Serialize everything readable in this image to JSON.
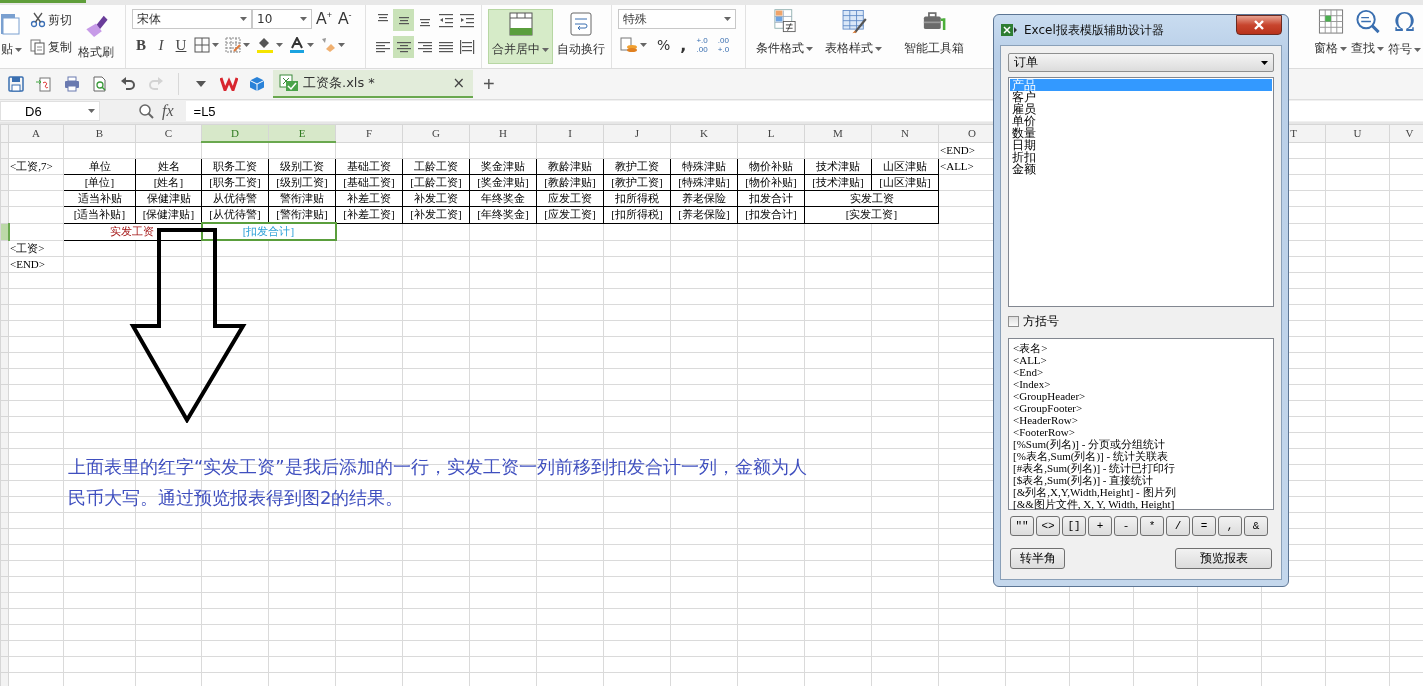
{
  "ribbon": {
    "paste": {
      "label": "贴"
    },
    "clipboard": [
      {
        "kind": "cut",
        "label": "剪切"
      },
      {
        "kind": "copy",
        "label": "复制"
      }
    ],
    "format_painter": {
      "label": "格式刷"
    },
    "font": {
      "name": "宋体",
      "size": "10",
      "size_buttons": [
        {
          "label": "A",
          "sign": "+"
        },
        {
          "label": "A",
          "sign": "-"
        }
      ],
      "styles": [
        {
          "kind": "bold",
          "label": "B"
        },
        {
          "kind": "italic",
          "label": "I"
        },
        {
          "kind": "underline",
          "label": "U"
        }
      ]
    },
    "alignment": [
      {
        "kind": "top",
        "selected": false
      },
      {
        "kind": "middle",
        "selected": true
      },
      {
        "kind": "bottom",
        "selected": false
      },
      {
        "kind": "outdent",
        "selected": false
      },
      {
        "kind": "indent",
        "selected": false
      },
      {
        "kind": "left",
        "selected": false
      },
      {
        "kind": "center",
        "selected": true
      },
      {
        "kind": "right",
        "selected": false
      },
      {
        "kind": "justify",
        "selected": false
      },
      {
        "kind": "distributed",
        "selected": false
      }
    ],
    "merge": {
      "label": "合并居中",
      "selected": true
    },
    "wrap": {
      "label": "自动换行",
      "selected": false
    },
    "number": {
      "format": "特殊",
      "percent": "%",
      "comma": ",",
      "decimals": [
        {
          "top": "+.0",
          "bottom": ".00"
        },
        {
          "top": ".00",
          "bottom": "+.0"
        }
      ]
    },
    "tools": [
      {
        "kind": "conditional",
        "label": "条件格式",
        "menu": true
      },
      {
        "kind": "table_style",
        "label": "表格样式",
        "menu": true
      },
      {
        "kind": "toolbox",
        "label": "智能工具箱",
        "menu": false
      }
    ],
    "right_tools": [
      {
        "kind": "freeze",
        "label": "窗格",
        "menu": true
      },
      {
        "kind": "find",
        "label": "查找",
        "menu": true
      },
      {
        "kind": "symbol",
        "glyph": "Ω",
        "label": "符号",
        "menu": true
      }
    ]
  },
  "quick_access": [
    {
      "kind": "save",
      "disabled": false
    },
    {
      "kind": "export",
      "disabled": false
    },
    {
      "kind": "print",
      "disabled": false
    },
    {
      "kind": "preview",
      "disabled": false
    },
    {
      "kind": "undo",
      "disabled": false
    },
    {
      "kind": "redo",
      "disabled": true
    }
  ],
  "document_tab": {
    "title": "工资条.xls *",
    "selected": true,
    "close": "×"
  },
  "new_tab": "+",
  "formula_bar": {
    "cell": "D6",
    "fx": "fx",
    "formula": "=L5"
  },
  "sheet": {
    "columns": [
      {
        "label": "A",
        "selected": false
      },
      {
        "label": "B",
        "selected": false
      },
      {
        "label": "C",
        "selected": false
      },
      {
        "label": "D",
        "selected": true
      },
      {
        "label": "E",
        "selected": true
      },
      {
        "label": "F",
        "selected": false
      },
      {
        "label": "G",
        "selected": false
      },
      {
        "label": "H",
        "selected": false
      },
      {
        "label": "I",
        "selected": false
      },
      {
        "label": "J",
        "selected": false
      },
      {
        "label": "K",
        "selected": false
      },
      {
        "label": "L",
        "selected": false
      },
      {
        "label": "M",
        "selected": false
      },
      {
        "label": "N",
        "selected": false
      },
      {
        "label": "O",
        "selected": false
      },
      {},
      {},
      {},
      {},
      {
        "label": "T",
        "selected": false
      },
      {
        "label": "U",
        "selected": false
      },
      {
        "label": "V",
        "selected": false
      }
    ],
    "rows": [
      {
        "selected": false,
        "cells": [
          {
            "selected": false
          },
          {
            "selected": false
          },
          {
            "selected": false
          },
          {
            "selected": false
          },
          {
            "selected": false
          },
          {
            "selected": false
          },
          {
            "selected": false
          },
          {
            "selected": false
          },
          {
            "selected": false
          },
          {
            "selected": false
          },
          {
            "selected": false
          },
          {
            "selected": false
          },
          {
            "selected": false
          },
          {
            "selected": false
          },
          {
            "text": "<END>",
            "kind": "tag",
            "boxed": false,
            "selected": false
          }
        ]
      },
      {
        "selected": false,
        "cells": [
          {
            "text": "<工资,7>",
            "kind": "tag",
            "boxed": false,
            "selected": false
          },
          {
            "text": "单位",
            "kind": "label",
            "boxed": true,
            "selected": false
          },
          {
            "text": "姓名",
            "kind": "label",
            "boxed": true,
            "selected": false
          },
          {
            "text": "职务工资",
            "kind": "label",
            "boxed": true,
            "selected": false
          },
          {
            "text": "级别工资",
            "kind": "label",
            "boxed": true,
            "selected": false
          },
          {
            "text": "基础工资",
            "kind": "label",
            "boxed": true,
            "selected": false
          },
          {
            "text": "工龄工资",
            "kind": "label",
            "boxed": true,
            "selected": false
          },
          {
            "text": "奖金津贴",
            "kind": "label",
            "boxed": true,
            "selected": false
          },
          {
            "text": "教龄津贴",
            "kind": "label",
            "boxed": true,
            "selected": false
          },
          {
            "text": "教护工资",
            "kind": "label",
            "boxed": true,
            "selected": false
          },
          {
            "text": "特殊津贴",
            "kind": "label",
            "boxed": true,
            "selected": false
          },
          {
            "text": "物价补贴",
            "kind": "label",
            "boxed": true,
            "selected": false
          },
          {
            "text": "技术津贴",
            "kind": "label",
            "boxed": true,
            "selected": false
          },
          {
            "text": "山区津贴",
            "kind": "label",
            "boxed": true,
            "selected": false
          },
          {
            "text": "<ALL>",
            "kind": "tag",
            "boxed": false,
            "selected": false
          }
        ]
      },
      {
        "selected": false,
        "cells": [
          {
            "selected": false
          },
          {
            "text": "[单位]",
            "kind": "field",
            "boxed": true,
            "selected": false
          },
          {
            "text": "[姓名]",
            "kind": "field",
            "boxed": true,
            "selected": false
          },
          {
            "text": "[职务工资]",
            "kind": "field",
            "boxed": true,
            "selected": false
          },
          {
            "text": "[级别工资]",
            "kind": "field",
            "boxed": true,
            "selected": false
          },
          {
            "text": "[基础工资]",
            "kind": "field",
            "boxed": true,
            "selected": false
          },
          {
            "text": "[工龄工资]",
            "kind": "field",
            "boxed": true,
            "selected": false
          },
          {
            "text": "[奖金津贴]",
            "kind": "field",
            "boxed": true,
            "selected": false
          },
          {
            "text": "[教龄津贴]",
            "kind": "field",
            "boxed": true,
            "selected": false
          },
          {
            "text": "[教护工资]",
            "kind": "field",
            "boxed": true,
            "selected": false
          },
          {
            "text": "[特殊津贴]",
            "kind": "field",
            "boxed": true,
            "selected": false
          },
          {
            "text": "[物价补贴]",
            "kind": "field",
            "boxed": true,
            "selected": false
          },
          {
            "text": "[技术津贴]",
            "kind": "field",
            "boxed": true,
            "selected": false
          },
          {
            "text": "[山区津贴]",
            "kind": "field",
            "boxed": true,
            "selected": false
          }
        ]
      },
      {
        "selected": false,
        "cells": [
          {
            "selected": false
          },
          {
            "text": "适当补贴",
            "kind": "label",
            "boxed": true,
            "selected": false
          },
          {
            "text": "保健津贴",
            "kind": "label",
            "boxed": true,
            "selected": false
          },
          {
            "text": "从优待警",
            "kind": "label",
            "boxed": true,
            "selected": false
          },
          {
            "text": "警衔津贴",
            "kind": "label",
            "boxed": true,
            "selected": false
          },
          {
            "text": "补差工资",
            "kind": "label",
            "boxed": true,
            "selected": false
          },
          {
            "text": "补发工资",
            "kind": "label",
            "boxed": true,
            "selected": false
          },
          {
            "text": "年终奖金",
            "kind": "label",
            "boxed": true,
            "selected": false
          },
          {
            "text": "应发工资",
            "kind": "label",
            "boxed": true,
            "selected": false
          },
          {
            "text": "扣所得税",
            "kind": "label",
            "boxed": true,
            "selected": false
          },
          {
            "text": "养老保险",
            "kind": "label",
            "boxed": true,
            "selected": false
          },
          {
            "text": "扣发合计",
            "kind": "label",
            "boxed": true,
            "selected": false
          },
          {
            "text": "实发工资",
            "kind": "label",
            "boxed": true,
            "colspan": 2,
            "selected": false
          }
        ]
      },
      {
        "selected": false,
        "cells": [
          {
            "selected": false
          },
          {
            "text": "[适当补贴]",
            "kind": "field",
            "boxed": true,
            "selected": false
          },
          {
            "text": "[保健津贴]",
            "kind": "field",
            "boxed": true,
            "selected": false
          },
          {
            "text": "[从优待警]",
            "kind": "field",
            "boxed": true,
            "selected": false
          },
          {
            "text": "[警衔津贴]",
            "kind": "field",
            "boxed": true,
            "selected": false
          },
          {
            "text": "[补差工资]",
            "kind": "field",
            "boxed": true,
            "selected": false
          },
          {
            "text": "[补发工资]",
            "kind": "field",
            "boxed": true,
            "selected": false
          },
          {
            "text": "[年终奖金]",
            "kind": "field",
            "boxed": true,
            "selected": false
          },
          {
            "text": "[应发工资]",
            "kind": "field",
            "boxed": true,
            "selected": false
          },
          {
            "text": "[扣所得税]",
            "kind": "field",
            "boxed": true,
            "selected": false
          },
          {
            "text": "[养老保险]",
            "kind": "field",
            "boxed": true,
            "selected": false
          },
          {
            "text": "[扣发合计]",
            "kind": "field",
            "boxed": true,
            "selected": false
          },
          {
            "text": "[实发工资]",
            "kind": "field",
            "boxed": true,
            "colspan": 2,
            "selected": false
          }
        ]
      },
      {
        "selected": true,
        "cells": [
          {
            "selected": false
          },
          {
            "text": "实发工资",
            "kind": "note",
            "boxed": true,
            "colspan": 2,
            "selected": false
          },
          {
            "text": "[扣发合计]",
            "kind": "ref",
            "boxed": false,
            "colspan": 2,
            "selected": true
          }
        ]
      },
      {
        "selected": false,
        "cells": [
          {
            "text": "<工资>",
            "kind": "tag",
            "boxed": false,
            "selected": false
          }
        ]
      },
      {
        "selected": false,
        "cells": [
          {
            "text": "<END>",
            "kind": "tag",
            "boxed": false,
            "selected": false
          }
        ]
      }
    ]
  },
  "note": "上面表里的红字“实发工资”是我后添加的一行，实发工资一列前移到扣发合计一列，金额为人民币大写。通过预览报表得到图2的结果。",
  "dialog": {
    "title": "Excel报表模版辅助设计器",
    "table": "订单",
    "fields": [
      {
        "label": "产品",
        "selected": true
      },
      {
        "label": "客户",
        "selected": false
      },
      {
        "label": "雇员",
        "selected": false
      },
      {
        "label": "单价",
        "selected": false
      },
      {
        "label": "数量",
        "selected": false
      },
      {
        "label": "日期",
        "selected": false
      },
      {
        "label": "折扣",
        "selected": false
      },
      {
        "label": "金额",
        "selected": false
      }
    ],
    "bracket_option": {
      "label": "方括号",
      "checked": false
    },
    "tokens": [
      "<表名>",
      "<ALL>",
      "<End>",
      "<Index>",
      "<GroupHeader>",
      "<GroupFooter>",
      "<HeaderRow>",
      "<FooterRow>",
      "[%Sum(列名)] - 分页或分组统计",
      "[%表名,Sum(列名)] - 统计关联表",
      "[#表名,Sum(列名)] - 统计已打印行",
      "[$表名,Sum(列名)] - 直接统计",
      "[&列名,X,Y,Width,Height] - 图片列",
      "[&&图片文件, X, Y, Width, Height]"
    ],
    "symbols": [
      "\"\"",
      "<>",
      "[]",
      "+",
      "-",
      "*",
      "/",
      "=",
      ",",
      "&"
    ],
    "buttons": [
      "转半角",
      "预览报表"
    ]
  }
}
